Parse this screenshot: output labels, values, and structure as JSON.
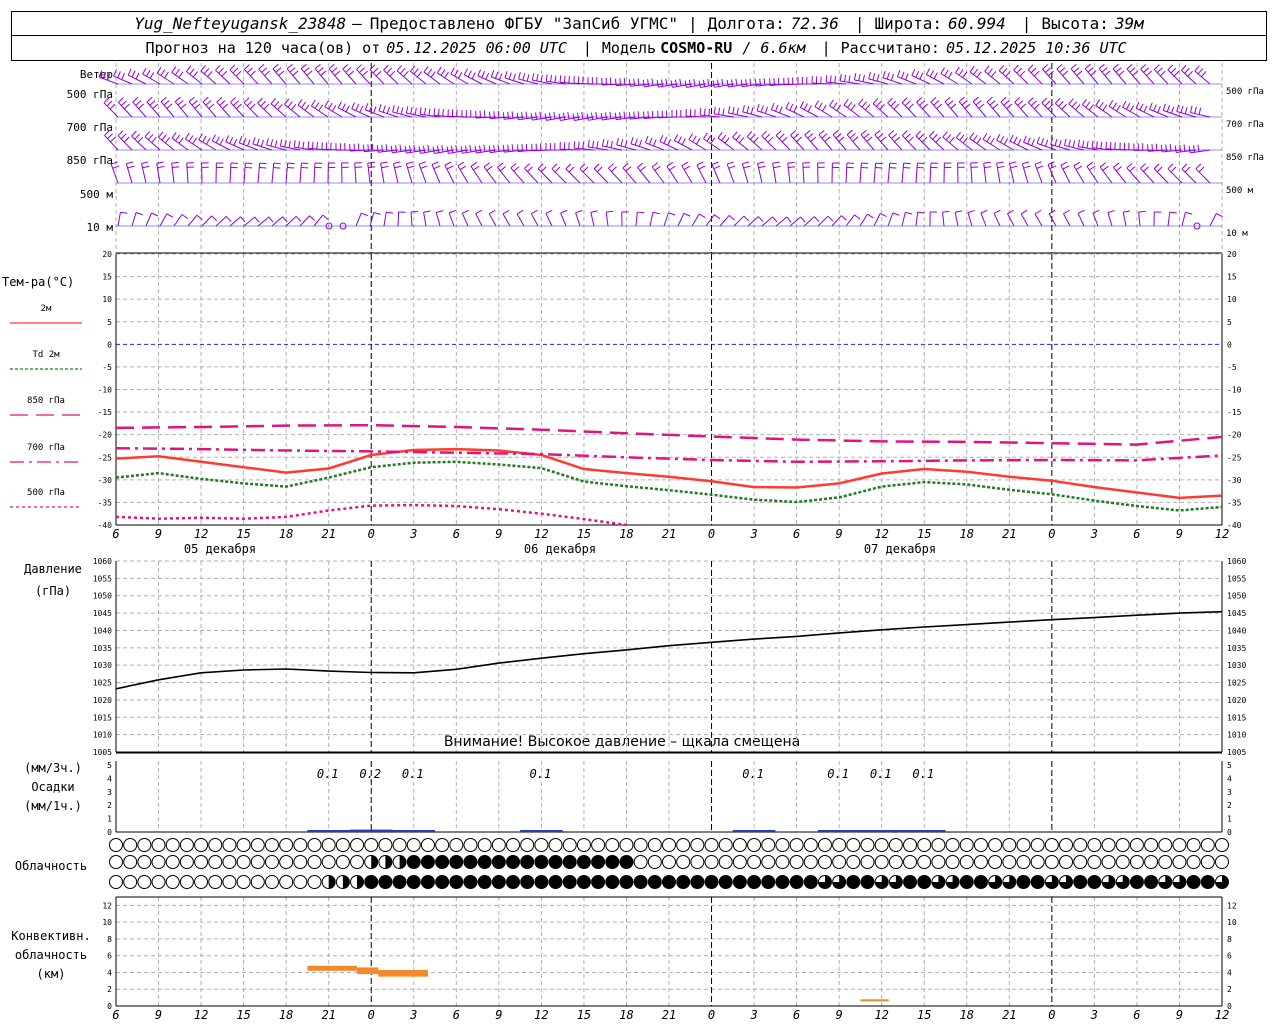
{
  "header": {
    "station": "Yug_Nefteyugansk_23848",
    "dash": "—",
    "provider": "Предоставлено ФГБУ \"ЗапСиб УГМС\"",
    "lon_label": "Долгота:",
    "lon": "72.36",
    "lat_label": "Широта:",
    "lat": "60.994",
    "alt_label": "Высота:",
    "alt": "39м",
    "forecast_prefix": "Прогноз на 120 часа(ов) от",
    "forecast_time": "05.12.2025 06:00 UTC",
    "model_label": "Модель",
    "model": "COSMO-RU",
    "resolution": "/ 6.6км",
    "calc_label": "Рассчитано:",
    "calc_time": "05.12.2025 10:36 UTC"
  },
  "wind": {
    "title": "Ветер",
    "levels": [
      "500 гПа",
      "700 гПа",
      "850 гПа",
      "500 м",
      "10 м"
    ],
    "color": "#9400d3"
  },
  "temperature": {
    "title": "Тем-ра(°C)",
    "legend": [
      {
        "label": "2м",
        "color": "#ff3b2f",
        "dash": "solid"
      },
      {
        "label": "Td 2м",
        "color": "#1e7d1e",
        "dash": "dotted"
      },
      {
        "label": "850 гПа",
        "color": "#e0147f",
        "dash": "solid"
      },
      {
        "label": "700 гПа",
        "color": "#e0147f",
        "dash": "dashdot"
      },
      {
        "label": "500 гПа",
        "color": "#e0147f",
        "dash": "dotted"
      }
    ],
    "ticks": [
      "20",
      "15",
      "10",
      "5",
      "0",
      "-5",
      "-10",
      "-15",
      "-20",
      "-25",
      "-30",
      "-35",
      "-40"
    ]
  },
  "time_axis": {
    "hour_labels": [
      "6",
      "9",
      "12",
      "15",
      "18",
      "21",
      "0",
      "3",
      "6",
      "9",
      "12",
      "15",
      "18",
      "21",
      "0",
      "3",
      "6",
      "9",
      "12",
      "15",
      "18",
      "21",
      "0",
      "3",
      "6",
      "9",
      "12"
    ],
    "day_labels": [
      "05 декабря",
      "06 декабря",
      "07 декабря"
    ]
  },
  "pressure": {
    "title": "Давление",
    "unit": "(гПа)",
    "ticks": [
      "1060",
      "1055",
      "1050",
      "1045",
      "1040",
      "1035",
      "1030",
      "1025",
      "1020",
      "1015",
      "1010",
      "1005"
    ],
    "warning": "Внимание! Высокое давление – щкала смещена"
  },
  "precip": {
    "unit3h": "(мм/3ч.)",
    "title": "Осадки",
    "unit1h": "(мм/1ч.)",
    "ticks": [
      "5",
      "4",
      "3",
      "2",
      "1",
      "0"
    ],
    "labels": [
      {
        "hour": 15,
        "text": "0.1"
      },
      {
        "hour": 18,
        "text": "0.2"
      },
      {
        "hour": 21,
        "text": "0.1"
      },
      {
        "hour": 30,
        "text": "0.1"
      },
      {
        "hour": 45,
        "text": "0.1"
      },
      {
        "hour": 51,
        "text": "0.1"
      },
      {
        "hour": 54,
        "text": "0.1"
      },
      {
        "hour": 57,
        "text": "0.1"
      }
    ]
  },
  "cloud": {
    "title": "Облачность"
  },
  "convective": {
    "title1": "Конвективн.",
    "title2": "облачность",
    "unit": "(км)",
    "ticks": [
      "12",
      "10",
      "8",
      "6",
      "4",
      "2",
      "0"
    ],
    "color": "#f08a2a"
  },
  "chart_data": [
    {
      "type": "line",
      "title": "Тем-ра(°C)",
      "x_unit": "hours since 05.12.2025 06:00 UTC",
      "ylim": [
        -40,
        20
      ],
      "series": [
        {
          "name": "2м",
          "x": [
            0,
            3,
            6,
            9,
            12,
            15,
            18,
            21,
            24,
            27,
            30,
            33,
            36,
            39,
            42,
            45,
            48,
            51,
            54,
            57,
            60,
            63,
            66,
            69,
            72,
            75,
            78
          ],
          "values": [
            -25.3,
            -24.8,
            -26.0,
            -27.2,
            -28.4,
            -27.5,
            -24.5,
            -23.4,
            -23.2,
            -23.5,
            -24.5,
            -27.6,
            -28.5,
            -29.3,
            -30.3,
            -31.6,
            -31.7,
            -30.8,
            -28.6,
            -27.6,
            -28.2,
            -29.3,
            -30.2,
            -31.6,
            -32.8,
            -34.0,
            -33.5
          ]
        },
        {
          "name": "Td 2м",
          "x": [
            0,
            3,
            6,
            9,
            12,
            15,
            18,
            21,
            24,
            27,
            30,
            33,
            36,
            39,
            42,
            45,
            48,
            51,
            54,
            57,
            60,
            63,
            66,
            69,
            72,
            75,
            78
          ],
          "values": [
            -29.5,
            -28.5,
            -29.8,
            -30.8,
            -31.5,
            -29.5,
            -27.2,
            -26.2,
            -26.0,
            -26.6,
            -27.4,
            -30.4,
            -31.4,
            -32.3,
            -33.3,
            -34.4,
            -34.9,
            -33.9,
            -31.5,
            -30.5,
            -31.0,
            -32.2,
            -33.2,
            -34.6,
            -35.8,
            -36.8,
            -36.0
          ]
        },
        {
          "name": "850 гПа",
          "x": [
            0,
            6,
            12,
            18,
            24,
            30,
            36,
            42,
            48,
            54,
            60,
            66,
            72,
            78
          ],
          "values": [
            -18.5,
            -18.3,
            -18.0,
            -17.9,
            -18.3,
            -18.9,
            -19.7,
            -20.4,
            -21.1,
            -21.5,
            -21.6,
            -21.9,
            -22.2,
            -20.5
          ]
        },
        {
          "name": "700 гПа",
          "x": [
            0,
            6,
            12,
            18,
            24,
            30,
            36,
            42,
            48,
            54,
            60,
            66,
            72,
            78
          ],
          "values": [
            -23.0,
            -23.2,
            -23.5,
            -23.7,
            -24.0,
            -24.3,
            -25.0,
            -25.6,
            -26.0,
            -25.9,
            -25.7,
            -25.6,
            -25.7,
            -24.6
          ]
        },
        {
          "name": "500 гПа",
          "x": [
            0,
            3,
            6,
            9,
            12,
            15,
            18,
            21,
            24,
            27,
            30,
            33,
            36
          ],
          "values": [
            -38.2,
            -38.6,
            -38.4,
            -38.6,
            -38.2,
            -36.8,
            -35.7,
            -35.6,
            -35.8,
            -36.5,
            -37.5,
            -38.7,
            -40.0
          ]
        }
      ]
    },
    {
      "type": "line",
      "title": "Давление",
      "x_unit": "hours since 05.12.2025 06:00 UTC",
      "ylim": [
        1005,
        1060
      ],
      "series": [
        {
          "name": "Давление",
          "x": [
            0,
            3,
            6,
            9,
            12,
            15,
            18,
            21,
            24,
            27,
            30,
            33,
            36,
            39,
            42,
            45,
            48,
            51,
            54,
            57,
            60,
            63,
            66,
            69,
            72,
            75,
            78
          ],
          "values": [
            1023.2,
            1025.8,
            1027.8,
            1028.6,
            1028.9,
            1028.3,
            1027.9,
            1027.8,
            1028.8,
            1030.6,
            1032.0,
            1033.3,
            1034.4,
            1035.6,
            1036.6,
            1037.5,
            1038.3,
            1039.3,
            1040.2,
            1041.0,
            1041.7,
            1042.4,
            1043.1,
            1043.7,
            1044.4,
            1045.0,
            1045.4
          ]
        }
      ]
    },
    {
      "type": "bar",
      "title": "Осадки",
      "x_unit": "hours since 05.12.2025 06:00 UTC",
      "ylim": [
        0,
        5
      ],
      "series": [
        {
          "name": "мм/3ч.",
          "x": [
            15,
            18,
            21,
            30,
            45,
            51,
            54,
            57
          ],
          "values": [
            0.1,
            0.2,
            0.1,
            0.1,
            0.1,
            0.1,
            0.1,
            0.1
          ]
        }
      ]
    },
    {
      "type": "bar",
      "title": "Конвективн. облачность",
      "x_unit": "hours since 05.12.2025 06:00 UTC",
      "ylim": [
        0,
        13
      ],
      "series": [
        {
          "name": "облачность (км)",
          "segments": [
            {
              "x0": 13.5,
              "x1": 17.0,
              "bottom": 4.2,
              "top": 4.8
            },
            {
              "x0": 17.0,
              "x1": 18.5,
              "bottom": 3.8,
              "top": 4.6
            },
            {
              "x0": 18.5,
              "x1": 22.0,
              "bottom": 3.5,
              "top": 4.3
            },
            {
              "x0": 52.5,
              "x1": 54.5,
              "bottom": 0.6,
              "top": 0.8
            }
          ]
        }
      ]
    }
  ]
}
